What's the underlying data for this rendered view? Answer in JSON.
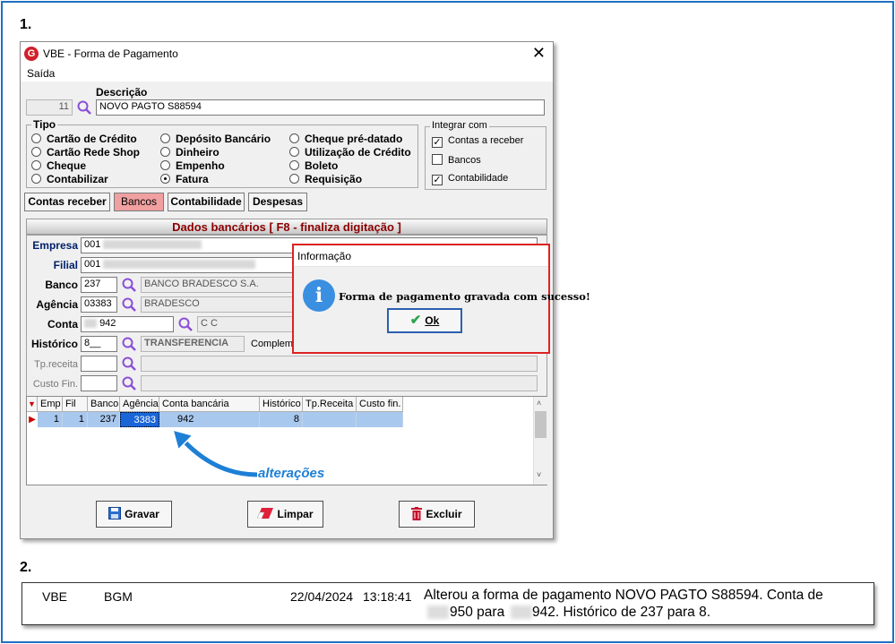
{
  "steps": {
    "one": "1.",
    "two": "2."
  },
  "window": {
    "title": "VBE - Forma de Pagamento",
    "menu": "Saída",
    "close": "✕"
  },
  "header": {
    "code": "11",
    "descricao_label": "Descrição",
    "descricao_value": "NOVO PAGTO S88594"
  },
  "tipo": {
    "title": "Tipo",
    "options": [
      {
        "label": "Cartão de Crédito",
        "selected": false
      },
      {
        "label": "Cartão Rede Shop",
        "selected": false
      },
      {
        "label": "Cheque",
        "selected": false
      },
      {
        "label": "Contabilizar",
        "selected": false
      },
      {
        "label": "Depósito Bancário",
        "selected": false
      },
      {
        "label": "Dinheiro",
        "selected": false
      },
      {
        "label": "Empenho",
        "selected": false
      },
      {
        "label": "Fatura",
        "selected": true
      },
      {
        "label": "Cheque pré-datado",
        "selected": false
      },
      {
        "label": "Utilização de Crédito",
        "selected": false
      },
      {
        "label": "Boleto",
        "selected": false
      },
      {
        "label": "Requisição",
        "selected": false
      }
    ]
  },
  "integrar": {
    "title": "Integrar com",
    "items": [
      {
        "label": "Contas a receber",
        "checked": true
      },
      {
        "label": "Bancos",
        "checked": false
      },
      {
        "label": "Contabilidade",
        "checked": true
      }
    ]
  },
  "tabs": [
    "Contas receber",
    "Bancos",
    "Contabilidade",
    "Despesas"
  ],
  "active_tab": "Bancos",
  "panel": {
    "title": "Dados bancários [ F8 - finaliza digitação ]",
    "empresa_label": "Empresa",
    "empresa_value": "001",
    "filial_label": "Filial",
    "filial_value": "001",
    "banco_label": "Banco",
    "banco_value": "237",
    "banco_nome": "BANCO BRADESCO S.A.",
    "agencia_label": "Agência",
    "agencia_value": "03383",
    "agencia_nome": "BRADESCO",
    "conta_label": "Conta",
    "conta_value": "942",
    "conta_tipo": "C C",
    "historico_label": "Histórico",
    "historico_value": "8__",
    "historico_nome": "TRANSFERENCIA",
    "complemento_label": "Compleme",
    "tpreceita_label": "Tp.receita",
    "custofin_label": "Custo Fin."
  },
  "grid": {
    "headers": [
      "Emp",
      "Fil",
      "Banco",
      "Agência",
      "Conta bancária",
      "Histórico",
      "Tp.Receita",
      "Custo fin."
    ],
    "row": [
      "1",
      "1",
      "237",
      "3383",
      "942",
      "8",
      "",
      ""
    ]
  },
  "buttons": {
    "gravar": "Gravar",
    "limpar": "Limpar",
    "excluir": "Excluir"
  },
  "dialog": {
    "title": "Informação",
    "message": "Forma de pagamento gravada com sucesso!",
    "ok": "Ok"
  },
  "annotation": "alterações",
  "log": {
    "system": "VBE",
    "user": "BGM",
    "date": "22/04/2024",
    "time": "13:18:41",
    "line1": "Alterou a forma de pagamento NOVO PAGTO S88594. Conta de",
    "line2_a": "950 para",
    "line2_b": "942. Histórico de 237 para 8."
  },
  "colors": {
    "frame": "#1f6fc4",
    "dialog_border": "#dd2222",
    "active_tab": "#f0a0a0",
    "panel_title": "#8b0000",
    "annotation": "#1e7fd6"
  }
}
